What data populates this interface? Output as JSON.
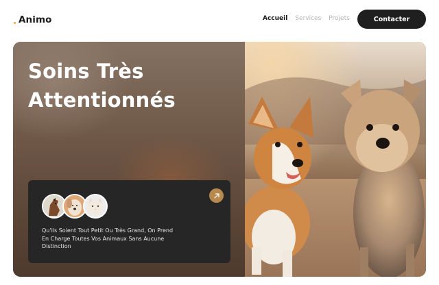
{
  "header": {
    "logo_text": "Animo",
    "nav": [
      {
        "label": "Accueil",
        "active": true
      },
      {
        "label": "Services",
        "active": false
      },
      {
        "label": "Projets",
        "active": false
      }
    ],
    "contact_label": "Contacter"
  },
  "hero": {
    "title_line1": "Soins Très",
    "title_line2": "Attentionnés",
    "card": {
      "text": "Qu'ils Soient Tout Petit Ou Très Grand, On Prend En Charge Toutes Vos Animaux Sans Aucune Distinction",
      "avatars": [
        "horse-avatar",
        "dog-avatar",
        "cat-avatar"
      ]
    }
  },
  "colors": {
    "accent": "#b8894f",
    "logo_dot": "#e6a83a",
    "dark": "#1f1f1f",
    "card": "#262626"
  }
}
